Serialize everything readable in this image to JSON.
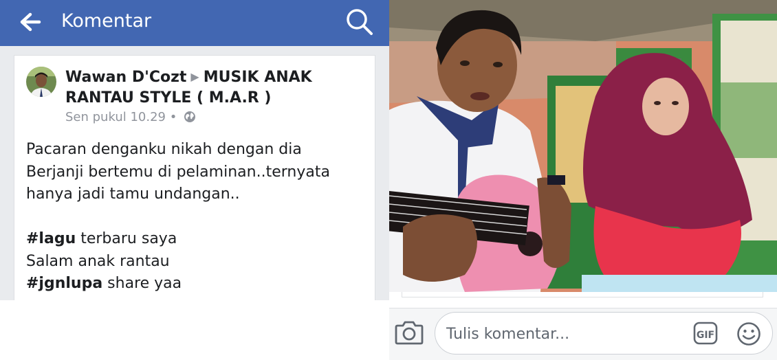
{
  "header": {
    "title": "Komentar",
    "back_icon": "arrow-left-icon",
    "search_icon": "search-icon",
    "background_color": "#4267b2"
  },
  "post": {
    "author": "Wawan D'Cozt",
    "group": "MUSIK ANAK RANTAU STYLE ( M.A.R )",
    "timestamp": "Sen pukul 10.29",
    "separator": "•",
    "privacy_icon": "globe-icon",
    "lines": [
      "Pacaran denganku nikah dengan dia",
      "Berjanji bertemu di pelaminan..ternyata",
      "hanya jadi tamu undangan.."
    ],
    "tag_line_1": {
      "tag": "#lagu",
      "rest": " terbaru saya"
    },
    "line_greeting": "Salam anak rantau",
    "tag_line_2": {
      "tag": "#jgnlupa",
      "rest": " share yaa"
    },
    "hashtag_color": "#1c1e21"
  },
  "video": {
    "content": "video-frame-two-people-guitar"
  },
  "comment_bar": {
    "camera_icon": "camera-icon",
    "placeholder": "Tulis komentar...",
    "gif_label": "GIF",
    "emoji_icon": "smiley-icon"
  }
}
